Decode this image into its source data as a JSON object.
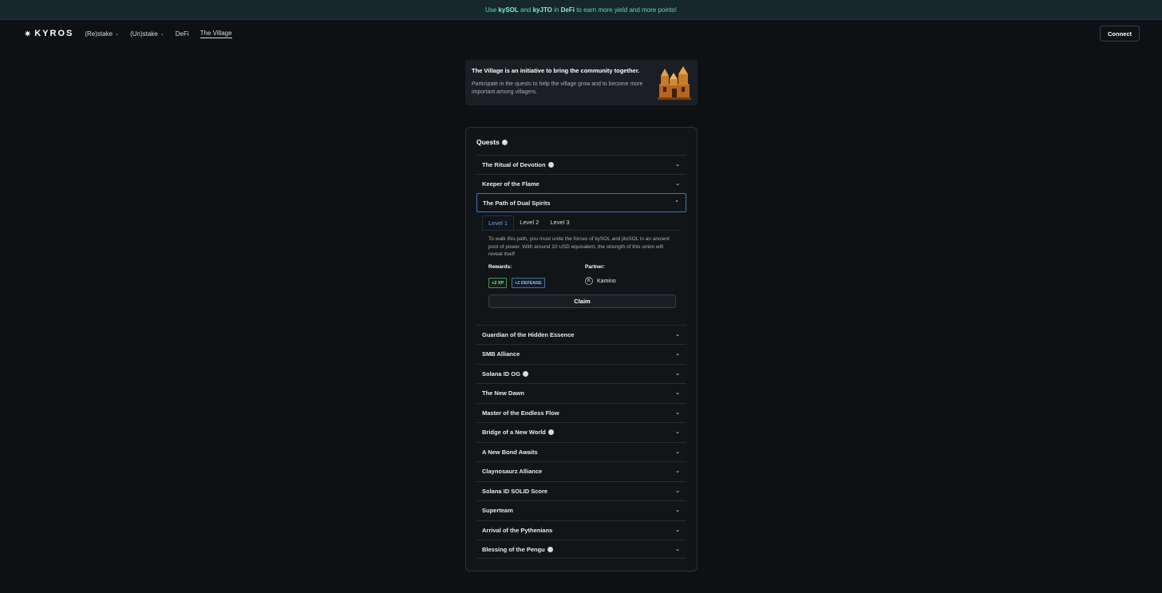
{
  "banner": {
    "p1": "Use",
    "kysol": "kySOL",
    "and": "and",
    "kyjto": "kyJTO",
    "in": "in",
    "defi": "DeFi",
    "p2": "to earn more yield and more points!"
  },
  "nav": {
    "logo": "KYROS",
    "logo_icon": "star-icon",
    "items": [
      {
        "label": "(Re)stake",
        "has_dropdown": true
      },
      {
        "label": "(Un)stake",
        "has_dropdown": true
      },
      {
        "label": "DeFi",
        "has_dropdown": false
      },
      {
        "label": "The Village",
        "has_dropdown": false,
        "active": true
      }
    ],
    "connect": "Connect"
  },
  "intro": {
    "title": "The Village is an initiative to bring the community together.",
    "description": "Participate in the quests to help the village grow and to become more important among villagers."
  },
  "quests": {
    "title": "Quests",
    "items": [
      {
        "label": "The Ritual of Devotion",
        "icon": true
      },
      {
        "label": "Keeper of the Flame",
        "icon": false
      },
      {
        "label": "The Path of Dual Spirits",
        "icon": false,
        "expanded": true
      },
      {
        "label": "Guardian of the Hidden Essence",
        "icon": false
      },
      {
        "label": "SMB Alliance",
        "icon": false
      },
      {
        "label": "Solana ID OG",
        "icon": true
      },
      {
        "label": "The New Dawn",
        "icon": false
      },
      {
        "label": "Master of the Endless Flow",
        "icon": false
      },
      {
        "label": "Bridge of a New World",
        "icon": true
      },
      {
        "label": "A New Bond Awaits",
        "icon": false
      },
      {
        "label": "Claynosaurz Alliance",
        "icon": false
      },
      {
        "label": "Solana ID SOLID Score",
        "icon": false
      },
      {
        "label": "Superteam",
        "icon": false
      },
      {
        "label": "Arrival of the Pythenians",
        "icon": false
      },
      {
        "label": "Blessing of the Pengu",
        "icon": true
      }
    ],
    "detail": {
      "tabs": [
        "Level 1",
        "Level 2",
        "Level 3"
      ],
      "active_tab": 0,
      "description": "To walk this path, you must unite the forces of kySOL and jitoSOL in an ancient pool of power. With around 10 USD equivalent, the strength of this union will reveal itself",
      "rewards_label": "Rewards:",
      "partner_label": "Partner:",
      "rewards": [
        "+2 XP",
        "+2 DEFENSE"
      ],
      "partner_initial": "K",
      "partner_name": "Kamino",
      "claim": "Claim"
    }
  },
  "colors": {
    "background": "#0e1114",
    "banner_bg": "#16282b",
    "banner_text": "#63d3c6",
    "accent_blue": "#3a78c2",
    "xp_green": "#8fe09f",
    "defense_blue": "#8fbef0"
  }
}
